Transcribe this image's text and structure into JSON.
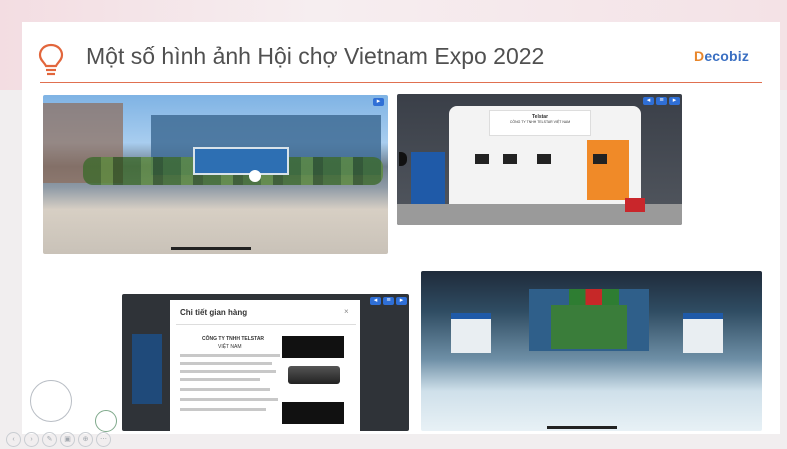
{
  "slide": {
    "title": "Một số hình ảnh Hội chợ Vietnam Expo 2022",
    "logo_first": "D",
    "logo_rest": "ecobiz",
    "accent_color": "#e07050"
  },
  "screenshots": {
    "booth_name": "Telstar",
    "booth_company": "CÔNG TY TNHH TELSTAR VIỆT NAM",
    "panel_title": "Chi tiết gian hàng",
    "panel_company_line1": "CÔNG TY TNHH TELSTAR",
    "panel_company_line2": "VIỆT NAM",
    "close_symbol": "×"
  },
  "controls": {
    "icons": [
      "left-icon",
      "right-icon",
      "pen-icon",
      "view-icon",
      "zoom-icon",
      "more-icon"
    ],
    "glyphs": [
      "‹",
      "›",
      "✎",
      "▣",
      "⊕",
      "⋯"
    ]
  }
}
